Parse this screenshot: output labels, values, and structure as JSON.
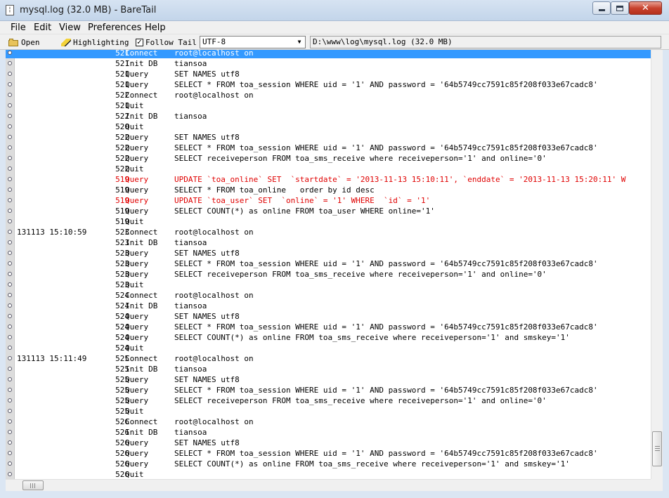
{
  "window": {
    "title": "mysql.log (32.0 MB) - BareTail"
  },
  "menu": [
    "File",
    "Edit",
    "View",
    "Preferences",
    "Help"
  ],
  "toolbar": {
    "open_label": "Open",
    "highlighting_label": "Highlighting",
    "follow_tail_label": "Follow Tail",
    "follow_tail_checked": true,
    "encoding": "UTF-8",
    "file_path": "D:\\www\\log\\mysql.log (32.0 MB)"
  },
  "colors": {
    "highlight_bg": "#3399ff",
    "error_text": "#e00000"
  },
  "log_lines": [
    {
      "ts": "",
      "id": "521",
      "cmd": "Connect",
      "arg": "root@localhost on",
      "style": "hl"
    },
    {
      "ts": "",
      "id": "521",
      "cmd": "Init DB",
      "arg": "tiansoa",
      "style": ""
    },
    {
      "ts": "",
      "id": "521",
      "cmd": "Query",
      "arg": "SET NAMES utf8",
      "style": ""
    },
    {
      "ts": "",
      "id": "521",
      "cmd": "Query",
      "arg": "SELECT * FROM toa_session WHERE uid = '1' AND password = '64b5749cc7591c85f208f033e67cadc8'",
      "style": ""
    },
    {
      "ts": "",
      "id": "522",
      "cmd": "Connect",
      "arg": "root@localhost on",
      "style": ""
    },
    {
      "ts": "",
      "id": "521",
      "cmd": "Quit",
      "arg": "",
      "style": ""
    },
    {
      "ts": "",
      "id": "522",
      "cmd": "Init DB",
      "arg": "tiansoa",
      "style": ""
    },
    {
      "ts": "",
      "id": "520",
      "cmd": "Quit",
      "arg": "",
      "style": ""
    },
    {
      "ts": "",
      "id": "522",
      "cmd": "Query",
      "arg": "SET NAMES utf8",
      "style": ""
    },
    {
      "ts": "",
      "id": "522",
      "cmd": "Query",
      "arg": "SELECT * FROM toa_session WHERE uid = '1' AND password = '64b5749cc7591c85f208f033e67cadc8'",
      "style": ""
    },
    {
      "ts": "",
      "id": "522",
      "cmd": "Query",
      "arg": "SELECT receiveperson FROM toa_sms_receive where receiveperson='1' and online='0'",
      "style": ""
    },
    {
      "ts": "",
      "id": "522",
      "cmd": "Quit",
      "arg": "",
      "style": ""
    },
    {
      "ts": "",
      "id": "519",
      "cmd": "Query",
      "arg": "UPDATE `toa_online` SET  `startdate` = '2013-11-13 15:10:11', `enddate` = '2013-11-13 15:20:11' W",
      "style": "red"
    },
    {
      "ts": "",
      "id": "519",
      "cmd": "Query",
      "arg": "SELECT * FROM toa_online   order by id desc",
      "style": ""
    },
    {
      "ts": "",
      "id": "519",
      "cmd": "Query",
      "arg": "UPDATE `toa_user` SET  `online` = '1' WHERE  `id` = '1'",
      "style": "red"
    },
    {
      "ts": "",
      "id": "519",
      "cmd": "Query",
      "arg": "SELECT COUNT(*) as online FROM toa_user WHERE online='1'",
      "style": ""
    },
    {
      "ts": "",
      "id": "519",
      "cmd": "Quit",
      "arg": "",
      "style": ""
    },
    {
      "ts": "131113 15:10:59",
      "id": "523",
      "cmd": "Connect",
      "arg": "root@localhost on",
      "style": ""
    },
    {
      "ts": "",
      "id": "523",
      "cmd": "Init DB",
      "arg": "tiansoa",
      "style": ""
    },
    {
      "ts": "",
      "id": "523",
      "cmd": "Query",
      "arg": "SET NAMES utf8",
      "style": ""
    },
    {
      "ts": "",
      "id": "523",
      "cmd": "Query",
      "arg": "SELECT * FROM toa_session WHERE uid = '1' AND password = '64b5749cc7591c85f208f033e67cadc8'",
      "style": ""
    },
    {
      "ts": "",
      "id": "523",
      "cmd": "Query",
      "arg": "SELECT receiveperson FROM toa_sms_receive where receiveperson='1' and online='0'",
      "style": ""
    },
    {
      "ts": "",
      "id": "523",
      "cmd": "Quit",
      "arg": "",
      "style": ""
    },
    {
      "ts": "",
      "id": "524",
      "cmd": "Connect",
      "arg": "root@localhost on",
      "style": ""
    },
    {
      "ts": "",
      "id": "524",
      "cmd": "Init DB",
      "arg": "tiansoa",
      "style": ""
    },
    {
      "ts": "",
      "id": "524",
      "cmd": "Query",
      "arg": "SET NAMES utf8",
      "style": ""
    },
    {
      "ts": "",
      "id": "524",
      "cmd": "Query",
      "arg": "SELECT * FROM toa_session WHERE uid = '1' AND password = '64b5749cc7591c85f208f033e67cadc8'",
      "style": ""
    },
    {
      "ts": "",
      "id": "524",
      "cmd": "Query",
      "arg": "SELECT COUNT(*) as online FROM toa_sms_receive where receiveperson='1' and smskey='1'",
      "style": ""
    },
    {
      "ts": "",
      "id": "524",
      "cmd": "Quit",
      "arg": "",
      "style": ""
    },
    {
      "ts": "131113 15:11:49",
      "id": "525",
      "cmd": "Connect",
      "arg": "root@localhost on",
      "style": ""
    },
    {
      "ts": "",
      "id": "525",
      "cmd": "Init DB",
      "arg": "tiansoa",
      "style": ""
    },
    {
      "ts": "",
      "id": "525",
      "cmd": "Query",
      "arg": "SET NAMES utf8",
      "style": ""
    },
    {
      "ts": "",
      "id": "525",
      "cmd": "Query",
      "arg": "SELECT * FROM toa_session WHERE uid = '1' AND password = '64b5749cc7591c85f208f033e67cadc8'",
      "style": ""
    },
    {
      "ts": "",
      "id": "525",
      "cmd": "Query",
      "arg": "SELECT receiveperson FROM toa_sms_receive where receiveperson='1' and online='0'",
      "style": ""
    },
    {
      "ts": "",
      "id": "525",
      "cmd": "Quit",
      "arg": "",
      "style": ""
    },
    {
      "ts": "",
      "id": "526",
      "cmd": "Connect",
      "arg": "root@localhost on",
      "style": ""
    },
    {
      "ts": "",
      "id": "526",
      "cmd": "Init DB",
      "arg": "tiansoa",
      "style": ""
    },
    {
      "ts": "",
      "id": "526",
      "cmd": "Query",
      "arg": "SET NAMES utf8",
      "style": ""
    },
    {
      "ts": "",
      "id": "526",
      "cmd": "Query",
      "arg": "SELECT * FROM toa_session WHERE uid = '1' AND password = '64b5749cc7591c85f208f033e67cadc8'",
      "style": ""
    },
    {
      "ts": "",
      "id": "526",
      "cmd": "Query",
      "arg": "SELECT COUNT(*) as online FROM toa_sms_receive where receiveperson='1' and smskey='1'",
      "style": ""
    },
    {
      "ts": "",
      "id": "526",
      "cmd": "Quit",
      "arg": "",
      "style": ""
    }
  ]
}
